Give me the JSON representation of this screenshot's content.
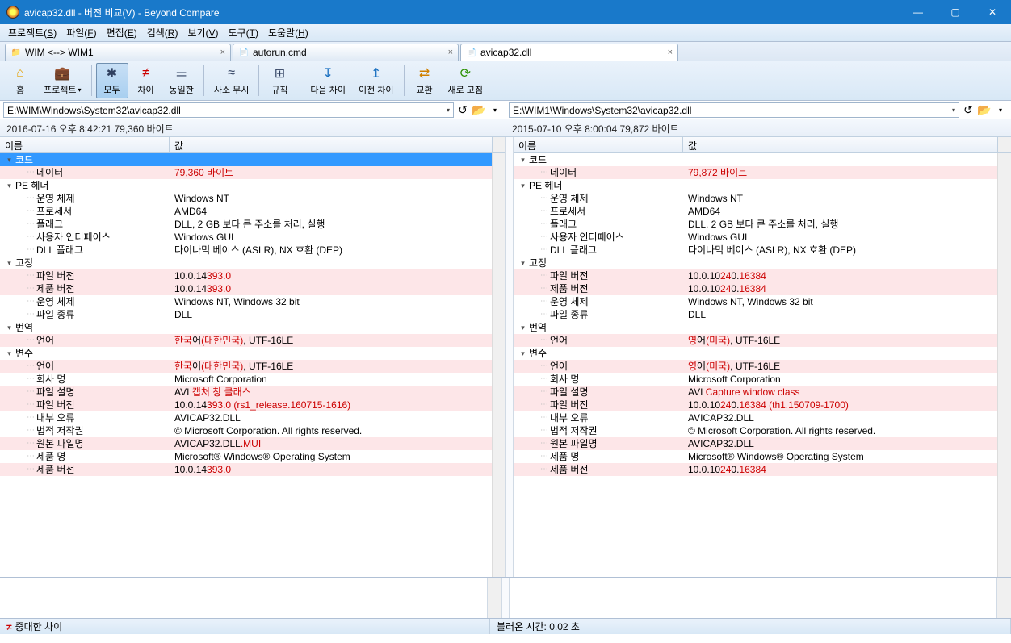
{
  "title": "avicap32.dll - 버전 비교(V) - Beyond Compare",
  "minimize": "—",
  "maximize": "▢",
  "close": "✕",
  "menu": [
    {
      "t": "프로젝트",
      "m": "S"
    },
    {
      "t": "파일",
      "m": "F"
    },
    {
      "t": "편집",
      "m": "E"
    },
    {
      "t": "검색",
      "m": "R"
    },
    {
      "t": "보기",
      "m": "V"
    },
    {
      "t": "도구",
      "m": "T"
    },
    {
      "t": "도움말",
      "m": "H"
    }
  ],
  "tabs": [
    {
      "icon": "📁",
      "label": "WIM <--> WIM1",
      "close": "×"
    },
    {
      "icon": "📄",
      "label": "autorun.cmd",
      "close": "×"
    },
    {
      "icon": "📄",
      "label": "avicap32.dll",
      "close": "×",
      "active": true
    }
  ],
  "toolbar": [
    {
      "icon": "⌂",
      "iconColor": "#e5a000",
      "label": "홈"
    },
    {
      "icon": "💼",
      "iconColor": "#caa050",
      "label": "프로젝트",
      "dd": true,
      "sepAfter": true
    },
    {
      "icon": "✱",
      "iconColor": "#304060",
      "label": "모두",
      "active": true
    },
    {
      "icon": "≠",
      "iconColor": "#cc0000",
      "label": "차이"
    },
    {
      "icon": "＝",
      "iconColor": "#304060",
      "label": "동일한",
      "sepAfter": true
    },
    {
      "icon": "≈",
      "iconColor": "#304060",
      "label": "사소 무시",
      "sepAfter": true
    },
    {
      "icon": "⊞",
      "iconColor": "#304060",
      "label": "규칙",
      "sepAfter": true
    },
    {
      "icon": "↧",
      "iconColor": "#1a70c0",
      "label": "다음 차이"
    },
    {
      "icon": "↥",
      "iconColor": "#1a70c0",
      "label": "이전 차이",
      "sepAfter": true
    },
    {
      "icon": "⇄",
      "iconColor": "#d08000",
      "label": "교환"
    },
    {
      "icon": "⟳",
      "iconColor": "#2a9000",
      "label": "새로 고침"
    }
  ],
  "path": {
    "left": "E:\\WIM\\Windows\\System32\\avicap32.dll",
    "right": "E:\\WIM1\\Windows\\System32\\avicap32.dll"
  },
  "meta": {
    "left": "2016-07-16 오후 8:42:21    79,360 바이트",
    "right": "2015-07-10 오후 8:00:04    79,872 바이트"
  },
  "colName": "이름",
  "colValue": "값",
  "rows_left": [
    {
      "d": 0,
      "name": "코드",
      "twisty": "open",
      "sel": true
    },
    {
      "d": 1,
      "name": "데이터",
      "val": {
        "k": "html",
        "v": "<span class='redtxt'>79,360 바이트</span>"
      },
      "diff": true
    },
    {
      "d": 0,
      "name": "PE 헤더",
      "twisty": "open"
    },
    {
      "d": 1,
      "name": "운영 체제",
      "val": {
        "v": "Windows NT"
      }
    },
    {
      "d": 1,
      "name": "프로세서",
      "val": {
        "v": "AMD64"
      }
    },
    {
      "d": 1,
      "name": "플래그",
      "val": {
        "v": "DLL, 2 GB 보다 큰 주소를 처리, 실행"
      }
    },
    {
      "d": 1,
      "name": "사용자 인터페이스",
      "val": {
        "v": "Windows GUI"
      }
    },
    {
      "d": 1,
      "name": "DLL 플래그",
      "val": {
        "v": "다이나믹 베이스 (ASLR), NX 호환 (DEP)"
      }
    },
    {
      "d": 0,
      "name": "고정",
      "twisty": "open"
    },
    {
      "d": 1,
      "name": "파일 버전",
      "val": {
        "k": "html",
        "v": "10.0.14<span class='redtxt'>393.0</span>"
      },
      "diff": true
    },
    {
      "d": 1,
      "name": "제품 버전",
      "val": {
        "k": "html",
        "v": "10.0.14<span class='redtxt'>393.0</span>"
      },
      "diff": true
    },
    {
      "d": 1,
      "name": "운영 체제",
      "val": {
        "v": "Windows NT, Windows 32 bit"
      }
    },
    {
      "d": 1,
      "name": "파일 종류",
      "val": {
        "v": "DLL"
      }
    },
    {
      "d": 0,
      "name": "번역",
      "twisty": "open"
    },
    {
      "d": 1,
      "name": "언어",
      "val": {
        "k": "html",
        "v": "<span class='redtxt'>한국</span>어<span class='redtxt'>(대한민국)</span>, UTF-16LE"
      },
      "diff": true
    },
    {
      "d": 0,
      "name": "변수",
      "twisty": "open"
    },
    {
      "d": 1,
      "name": "언어",
      "val": {
        "k": "html",
        "v": "<span class='redtxt'>한국</span>어<span class='redtxt'>(대한민국)</span>, UTF-16LE"
      },
      "diff": true
    },
    {
      "d": 1,
      "name": "회사 명",
      "val": {
        "v": "Microsoft Corporation"
      }
    },
    {
      "d": 1,
      "name": "파일 설명",
      "val": {
        "k": "html",
        "v": "AVI <span class='redtxt'>캡처 창 클래스</span>"
      },
      "diff": true
    },
    {
      "d": 1,
      "name": "파일 버전",
      "val": {
        "k": "html",
        "v": "10.0.14<span class='redtxt'>393.0 (rs1_release.160715-1616)</span>"
      },
      "diff": true
    },
    {
      "d": 1,
      "name": "내부 오류",
      "val": {
        "v": "AVICAP32.DLL"
      }
    },
    {
      "d": 1,
      "name": "법적 저작권",
      "val": {
        "v": "© Microsoft Corporation. All rights reserved."
      }
    },
    {
      "d": 1,
      "name": "원본 파일명",
      "val": {
        "k": "html",
        "v": "AVICAP32.DLL<span class='redtxt'>.MUI</span>"
      },
      "diff": true
    },
    {
      "d": 1,
      "name": "제품 명",
      "val": {
        "v": "Microsoft® Windows® Operating System"
      }
    },
    {
      "d": 1,
      "name": "제품 버전",
      "val": {
        "k": "html",
        "v": "10.0.14<span class='redtxt'>393.0</span>"
      },
      "diff": true
    }
  ],
  "rows_right": [
    {
      "d": 0,
      "name": "코드",
      "twisty": "open"
    },
    {
      "d": 1,
      "name": "데이터",
      "val": {
        "k": "html",
        "v": "<span class='redtxt'>79,872 바이트</span>"
      },
      "diff": true
    },
    {
      "d": 0,
      "name": "PE 헤더",
      "twisty": "open"
    },
    {
      "d": 1,
      "name": "운영 체제",
      "val": {
        "v": "Windows NT"
      }
    },
    {
      "d": 1,
      "name": "프로세서",
      "val": {
        "v": "AMD64"
      }
    },
    {
      "d": 1,
      "name": "플래그",
      "val": {
        "v": "DLL, 2 GB 보다 큰 주소를 처리, 실행"
      }
    },
    {
      "d": 1,
      "name": "사용자 인터페이스",
      "val": {
        "v": "Windows GUI"
      }
    },
    {
      "d": 1,
      "name": "DLL 플래그",
      "val": {
        "v": "다이나믹 베이스 (ASLR), NX 호환 (DEP)"
      }
    },
    {
      "d": 0,
      "name": "고정",
      "twisty": "open"
    },
    {
      "d": 1,
      "name": "파일 버전",
      "val": {
        "k": "html",
        "v": "10.0.10<span class='redtxt'>24</span>0.<span class='redtxt'>16384</span>"
      },
      "diff": true
    },
    {
      "d": 1,
      "name": "제품 버전",
      "val": {
        "k": "html",
        "v": "10.0.10<span class='redtxt'>24</span>0.<span class='redtxt'>16384</span>"
      },
      "diff": true
    },
    {
      "d": 1,
      "name": "운영 체제",
      "val": {
        "v": "Windows NT, Windows 32 bit"
      }
    },
    {
      "d": 1,
      "name": "파일 종류",
      "val": {
        "v": "DLL"
      }
    },
    {
      "d": 0,
      "name": "번역",
      "twisty": "open"
    },
    {
      "d": 1,
      "name": "언어",
      "val": {
        "k": "html",
        "v": "<span class='redtxt'>영</span>어<span class='redtxt'>(미국)</span>, UTF-16LE"
      },
      "diff": true
    },
    {
      "d": 0,
      "name": "변수",
      "twisty": "open"
    },
    {
      "d": 1,
      "name": "언어",
      "val": {
        "k": "html",
        "v": "<span class='redtxt'>영</span>어<span class='redtxt'>(미국)</span>, UTF-16LE"
      },
      "diff": true
    },
    {
      "d": 1,
      "name": "회사 명",
      "val": {
        "v": "Microsoft Corporation"
      }
    },
    {
      "d": 1,
      "name": "파일 설명",
      "val": {
        "k": "html",
        "v": "AVI <span class='redtxt'>Capture window class</span>"
      },
      "diff": true
    },
    {
      "d": 1,
      "name": "파일 버전",
      "val": {
        "k": "html",
        "v": "10.0.10<span class='redtxt'>24</span>0.<span class='redtxt'>16384 (th1.150709-1700)</span>"
      },
      "diff": true
    },
    {
      "d": 1,
      "name": "내부 오류",
      "val": {
        "v": "AVICAP32.DLL"
      }
    },
    {
      "d": 1,
      "name": "법적 저작권",
      "val": {
        "v": "© Microsoft Corporation. All rights reserved."
      }
    },
    {
      "d": 1,
      "name": "원본 파일명",
      "val": {
        "k": "html",
        "v": "AVICAP32.DLL"
      },
      "diff": true
    },
    {
      "d": 1,
      "name": "제품 명",
      "val": {
        "v": "Microsoft® Windows® Operating System"
      }
    },
    {
      "d": 1,
      "name": "제품 버전",
      "val": {
        "k": "html",
        "v": "10.0.10<span class='redtxt'>24</span>0.<span class='redtxt'>16384</span>"
      },
      "diff": true
    }
  ],
  "status": {
    "leftIcon": "≠",
    "left": "중대한 차이",
    "right": "불러온 시간: 0.02 초"
  }
}
